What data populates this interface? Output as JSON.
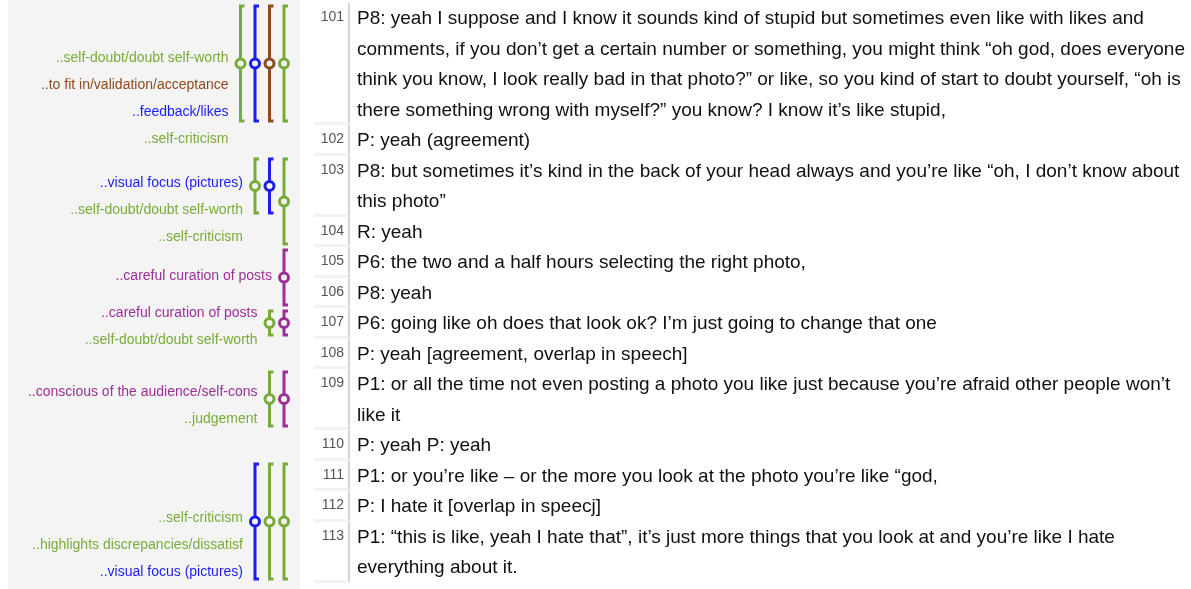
{
  "coding_groups": [
    {
      "stripes": [
        {
          "color": "#78ac3a"
        },
        {
          "color": "#1c1cf0"
        },
        {
          "color": "#8e4a1c"
        },
        {
          "color": "#78ac3a"
        }
      ],
      "labels": [
        {
          "text": "..self-doubt/doubt self-worth",
          "color": "#78ac3a"
        },
        {
          "text": "..to fit in/validation/acceptance",
          "color": "#8e4a1c"
        },
        {
          "text": "..feedback/likes",
          "color": "#1c1cf0"
        },
        {
          "text": "..self-criticism",
          "color": "#78ac3a"
        }
      ]
    },
    {
      "stripes": [
        {
          "color": "#78ac3a"
        },
        {
          "color": "#1c1cf0"
        },
        {
          "color": "#78ac3a"
        }
      ],
      "labels": [
        {
          "text": "..visual focus (pictures)",
          "color": "#1c1cf0"
        },
        {
          "text": "..self-doubt/doubt self-worth",
          "color": "#78ac3a"
        },
        {
          "text": "..self-criticism",
          "color": "#78ac3a"
        }
      ]
    },
    {
      "stripes": [
        {
          "color": "#9c2f98"
        }
      ],
      "labels": [
        {
          "text": "..careful curation of posts",
          "color": "#9c2f98"
        }
      ]
    },
    {
      "stripes": [
        {
          "color": "#78ac3a"
        },
        {
          "color": "#9c2f98"
        }
      ],
      "labels": [
        {
          "text": "..careful curation of posts",
          "color": "#9c2f98"
        },
        {
          "text": "..self-doubt/doubt self-worth",
          "color": "#78ac3a"
        }
      ]
    },
    {
      "stripes": [
        {
          "color": "#78ac3a"
        },
        {
          "color": "#9c2f98"
        }
      ],
      "labels": [
        {
          "text": "..conscious of the audience/self-cons",
          "color": "#9c2f98"
        },
        {
          "text": "..judgement",
          "color": "#78ac3a"
        }
      ]
    },
    {
      "stripes": [
        {
          "color": "#1c1cf0"
        },
        {
          "color": "#78ac3a"
        },
        {
          "color": "#78ac3a"
        }
      ],
      "labels": [
        {
          "text": "..self-criticism",
          "color": "#78ac3a"
        },
        {
          "text": "..highlights discrepancies/dissatisf",
          "color": "#78ac3a"
        },
        {
          "text": "..visual focus (pictures)",
          "color": "#1c1cf0"
        }
      ]
    }
  ],
  "transcript": {
    "rows": [
      {
        "line": "101",
        "text": "P8: yeah I suppose and I know it sounds kind of stupid but sometimes even like with likes and comments, if you don’t get a certain number or something, you might think “oh god, does everyone think you know, I look really bad in that photo?” or like, so you kind of start to doubt yourself, “oh is there something wrong with myself?” you know? I know it’s like stupid,"
      },
      {
        "line": "102",
        "text": "P: yeah (agreement)"
      },
      {
        "line": "103",
        "text": "P8: but sometimes it’s kind in the back of your head always and you’re like “oh, I don’t know about this photo”"
      },
      {
        "line": "104",
        "text": "R: yeah"
      },
      {
        "line": "105",
        "text": "P6: the two and a half hours selecting the right photo,"
      },
      {
        "line": "106",
        "text": "P8: yeah"
      },
      {
        "line": "107",
        "text": "P6: going like oh does that look ok? I’m just going to change that one"
      },
      {
        "line": "108",
        "text": "P: yeah [agreement, overlap in speech]"
      },
      {
        "line": "109",
        "text": "P1: or all the time not even posting a photo you like just because you’re afraid other people won’t like it"
      },
      {
        "line": "110",
        "text": "P: yeah P: yeah"
      },
      {
        "line": "111",
        "text": "P1: or you’re like – or the more you look at the photo you’re like “god,"
      },
      {
        "line": "112",
        "text": "P: I hate it [overlap in speecj]"
      },
      {
        "line": "113",
        "text": "P1: “this is like, yeah I hate that”, it’s just more things that you look at and you’re like I hate everything about it."
      }
    ]
  }
}
